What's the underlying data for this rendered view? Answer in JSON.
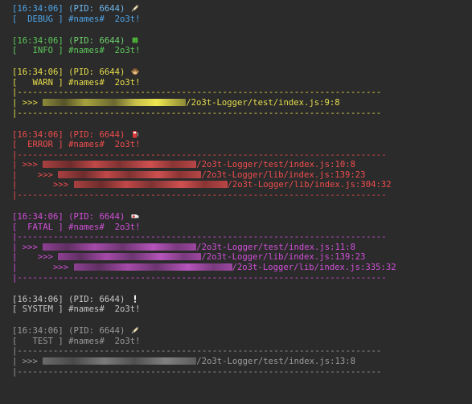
{
  "timestamp": "[16:34:06]",
  "pid": "(PID: 6644)",
  "names": "#names#",
  "message": "2o3t!",
  "entries": {
    "debug": {
      "level": "[  DEBUG ]"
    },
    "info": {
      "level": "[   INFO ]"
    },
    "warn": {
      "level": "[   WARN ]",
      "separator": "|-----------------------------------------------------------------------",
      "stack": [
        {
          "prefix": "| >>> ",
          "path": "/2o3t-Logger/test/index.js:9:8"
        }
      ]
    },
    "error": {
      "level": "[  ERROR ]",
      "separator": "|------------------------------------------------------------------------",
      "stack": [
        {
          "prefix": "| >>> ",
          "path": "/2o3t-Logger/test/index.js:10:8"
        },
        {
          "prefix": "|    >>> ",
          "path": "/2o3t-Logger/lib/index.js:139:23"
        },
        {
          "prefix": "|       >>> ",
          "path": "/2o3t-Logger/lib/index.js:304:32"
        }
      ]
    },
    "fatal": {
      "level": "[  FATAL ]",
      "separator": "|------------------------------------------------------------------------",
      "stack": [
        {
          "prefix": "| >>> ",
          "path": "/2o3t-Logger/test/index.js:11:8"
        },
        {
          "prefix": "|    >>> ",
          "path": "/2o3t-Logger/lib/index.js:139:23"
        },
        {
          "prefix": "|       >>> ",
          "path": "/2o3t-Logger/lib/index.js:335:32"
        }
      ]
    },
    "system": {
      "level": "[ SYSTEM ]"
    },
    "test": {
      "level": "[   TEST ]",
      "separator": "|-----------------------------------------------------------------------",
      "stack": [
        {
          "prefix": "| >>> ",
          "path": "/2o3t-Logger/test/index.js:13:8"
        }
      ]
    }
  },
  "icons": {
    "debug": "syringe-icon",
    "info": "four-leaf-clover-icon",
    "warn": "monkey-face-icon",
    "error": "fuel-pump-icon",
    "fatal": "ambulance-icon",
    "system": "exclamation-icon",
    "test": "syringe-icon"
  },
  "colors": {
    "background": "#2b2b2b",
    "debug": "#4ea6ea",
    "info": "#5cc85a",
    "warn": "#e6dd4a",
    "error": "#ef4d4d",
    "fatal": "#d14fd8",
    "system": "#c8c8c8",
    "test": "#9a9a9a"
  }
}
